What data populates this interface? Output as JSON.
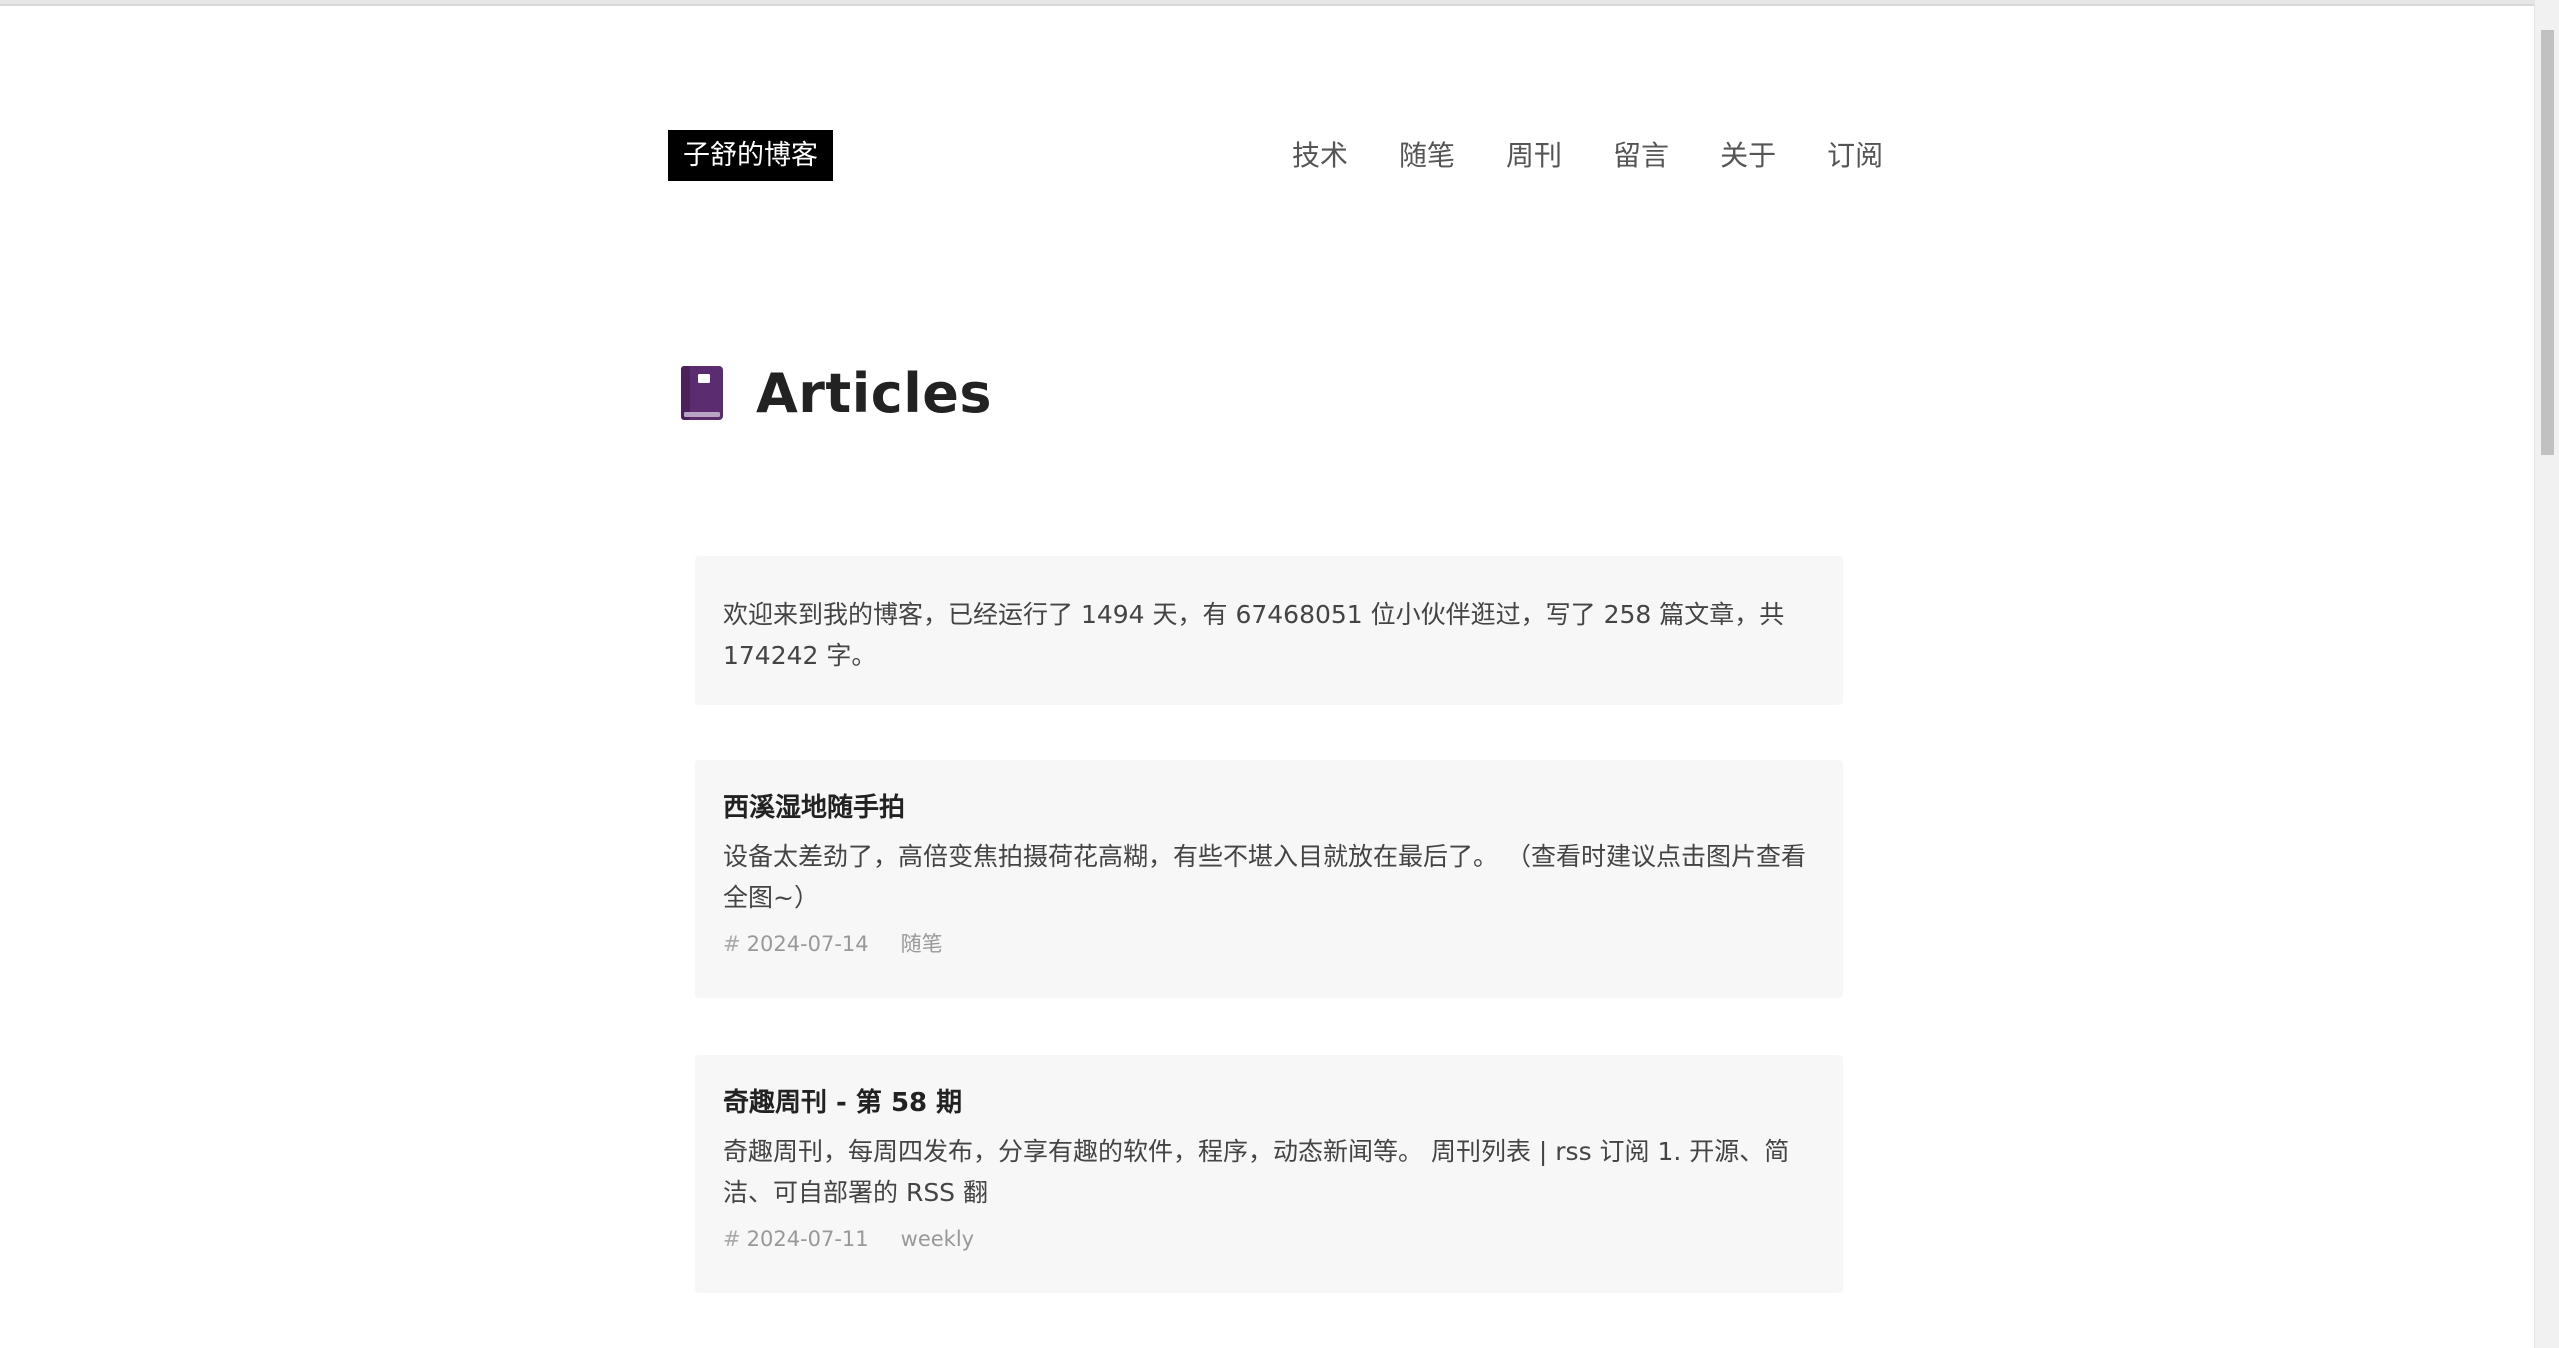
{
  "header": {
    "logo": "子舒的博客",
    "nav": [
      {
        "label": "技术"
      },
      {
        "label": "随笔"
      },
      {
        "label": "周刊"
      },
      {
        "label": "留言"
      },
      {
        "label": "关于"
      },
      {
        "label": "订阅"
      }
    ]
  },
  "page": {
    "title": "Articles",
    "icon": "book-icon"
  },
  "intro": {
    "text": "欢迎来到我的博客，已经运行了 1494 天，有 67468051 位小伙伴逛过，写了 258 篇文章，共 174242 字。"
  },
  "posts": [
    {
      "title": "西溪湿地随手拍",
      "summary": "设备太差劲了，高倍变焦拍摄荷花高糊，有些不堪入目就放在最后了。 （查看时建议点击图片查看全图~）",
      "hash": "#",
      "date": "2024-07-14",
      "category": "随笔"
    },
    {
      "title": "奇趣周刊 - 第 58 期",
      "summary": "奇趣周刊，每周四发布，分享有趣的软件，程序，动态新闻等。 周刊列表 | rss 订阅 1. 开源、简洁、可自部署的 RSS 翻",
      "hash": "#",
      "date": "2024-07-11",
      "category": "weekly"
    }
  ],
  "colors": {
    "logo_bg": "#000000",
    "card_bg": "#f7f7f7",
    "book_icon": "#5b2c6f"
  }
}
